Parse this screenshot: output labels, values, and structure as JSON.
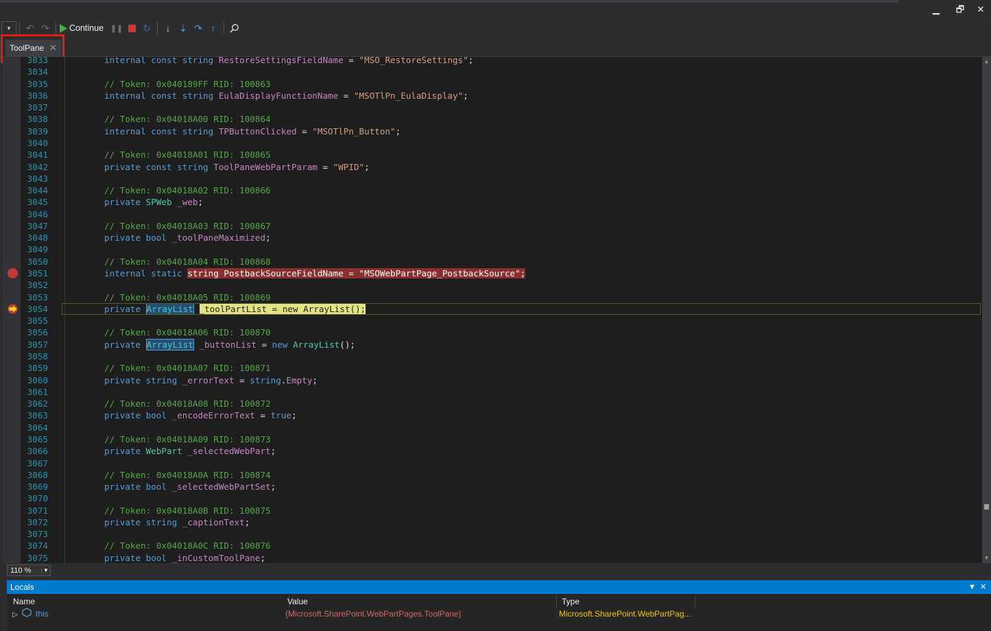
{
  "window": {
    "minimize_label": "▁",
    "maximize_label": "🗗",
    "close_label": "✕"
  },
  "toolbar": {
    "continue_label": "Continue"
  },
  "tab": {
    "title": "ToolPane",
    "close_label": "✕"
  },
  "editor": {
    "zoom": "110 %",
    "breakpoint_line": 3051,
    "current_line": 3054,
    "lines": [
      {
        "n": "3033",
        "t": ""
      },
      {
        "n": "3034",
        "t": ""
      },
      {
        "n": "3035",
        "t": ""
      },
      {
        "n": "3036",
        "t": ""
      },
      {
        "n": "3037",
        "t": ""
      },
      {
        "n": "3038",
        "t": ""
      },
      {
        "n": "3039",
        "t": ""
      },
      {
        "n": "3040",
        "t": ""
      },
      {
        "n": "3041",
        "t": ""
      },
      {
        "n": "3042",
        "t": ""
      },
      {
        "n": "3043",
        "t": ""
      },
      {
        "n": "3044",
        "t": ""
      },
      {
        "n": "3045",
        "t": ""
      },
      {
        "n": "3046",
        "t": ""
      },
      {
        "n": "3047",
        "t": ""
      },
      {
        "n": "3048",
        "t": ""
      },
      {
        "n": "3049",
        "t": ""
      },
      {
        "n": "3050",
        "t": ""
      },
      {
        "n": "3051",
        "t": ""
      },
      {
        "n": "3052",
        "t": ""
      },
      {
        "n": "3053",
        "t": ""
      },
      {
        "n": "3054",
        "t": ""
      },
      {
        "n": "3055",
        "t": ""
      },
      {
        "n": "3056",
        "t": ""
      },
      {
        "n": "3057",
        "t": ""
      },
      {
        "n": "3058",
        "t": ""
      },
      {
        "n": "3059",
        "t": ""
      },
      {
        "n": "3060",
        "t": ""
      },
      {
        "n": "3061",
        "t": ""
      },
      {
        "n": "3062",
        "t": ""
      },
      {
        "n": "3063",
        "t": ""
      },
      {
        "n": "3064",
        "t": ""
      },
      {
        "n": "3065",
        "t": ""
      },
      {
        "n": "3066",
        "t": ""
      },
      {
        "n": "3067",
        "t": ""
      },
      {
        "n": "3068",
        "t": ""
      },
      {
        "n": "3069",
        "t": ""
      },
      {
        "n": "3070",
        "t": ""
      },
      {
        "n": "3071",
        "t": ""
      },
      {
        "n": "3072",
        "t": ""
      },
      {
        "n": "3073",
        "t": ""
      },
      {
        "n": "3074",
        "t": ""
      },
      {
        "n": "3075",
        "t": ""
      }
    ],
    "code": {
      "3033": [
        [
          "kw",
          "internal const string "
        ],
        [
          "fld",
          "RestoreSettingsFieldName"
        ],
        [
          "pl",
          " = "
        ],
        [
          "str",
          "\"MSO_RestoreSettings\""
        ],
        [
          "pl",
          ";"
        ]
      ],
      "3035": [
        [
          "cm",
          "// Token: 0x040189FF RID: 100863"
        ]
      ],
      "3036": [
        [
          "kw",
          "internal const string "
        ],
        [
          "fld",
          "EulaDisplayFunctionName"
        ],
        [
          "pl",
          " = "
        ],
        [
          "str",
          "\"MSOTlPn_EulaDisplay\""
        ],
        [
          "pl",
          ";"
        ]
      ],
      "3038": [
        [
          "cm",
          "// Token: 0x04018A00 RID: 100864"
        ]
      ],
      "3039": [
        [
          "kw",
          "internal const string "
        ],
        [
          "fld",
          "TPButtonClicked"
        ],
        [
          "pl",
          " = "
        ],
        [
          "str",
          "\"MSOTlPn_Button\""
        ],
        [
          "pl",
          ";"
        ]
      ],
      "3041": [
        [
          "cm",
          "// Token: 0x04018A01 RID: 100865"
        ]
      ],
      "3042": [
        [
          "kw",
          "private const string "
        ],
        [
          "fld",
          "ToolPaneWebPartParam"
        ],
        [
          "pl",
          " = "
        ],
        [
          "str",
          "\"WPID\""
        ],
        [
          "pl",
          ";"
        ]
      ],
      "3044": [
        [
          "cm",
          "// Token: 0x04018A02 RID: 100866"
        ]
      ],
      "3045": [
        [
          "kw",
          "private "
        ],
        [
          "ty",
          "SPWeb"
        ],
        [
          "pl",
          " "
        ],
        [
          "fld",
          "_web"
        ],
        [
          "pl",
          ";"
        ]
      ],
      "3047": [
        [
          "cm",
          "// Token: 0x04018A03 RID: 100867"
        ]
      ],
      "3048": [
        [
          "kw",
          "private bool "
        ],
        [
          "fld",
          "_toolPaneMaximized"
        ],
        [
          "pl",
          ";"
        ]
      ],
      "3050": [
        [
          "cm",
          "// Token: 0x04018A04 RID: 100868"
        ]
      ],
      "3051": [
        [
          "kw",
          "internal static "
        ],
        [
          "bp",
          "string PostbackSourceFieldName = \"MSOWebPartPage_PostbackSource\";"
        ]
      ],
      "3053": [
        [
          "cm",
          "// Token: 0x04018A05 RID: 100869"
        ]
      ],
      "3054": [
        [
          "kw",
          "private "
        ],
        [
          "ref",
          "ArrayList"
        ],
        [
          "pl",
          " "
        ],
        [
          "ex",
          "_toolPartList = new ArrayList();"
        ]
      ],
      "3056": [
        [
          "cm",
          "// Token: 0x04018A06 RID: 100870"
        ]
      ],
      "3057": [
        [
          "kw",
          "private "
        ],
        [
          "ref",
          "ArrayList"
        ],
        [
          "pl",
          " "
        ],
        [
          "fld",
          "_buttonList"
        ],
        [
          "pl",
          " = "
        ],
        [
          "kw",
          "new "
        ],
        [
          "ty",
          "ArrayList"
        ],
        [
          "pl",
          "();"
        ]
      ],
      "3059": [
        [
          "cm",
          "// Token: 0x04018A07 RID: 100871"
        ]
      ],
      "3060": [
        [
          "kw",
          "private string "
        ],
        [
          "fld",
          "_errorText"
        ],
        [
          "pl",
          " = "
        ],
        [
          "kw",
          "string"
        ],
        [
          "pl",
          "."
        ],
        [
          "fld",
          "Empty"
        ],
        [
          "pl",
          ";"
        ]
      ],
      "3062": [
        [
          "cm",
          "// Token: 0x04018A08 RID: 100872"
        ]
      ],
      "3063": [
        [
          "kw",
          "private bool "
        ],
        [
          "fld",
          "_encodeErrorText"
        ],
        [
          "pl",
          " = "
        ],
        [
          "kw",
          "true"
        ],
        [
          "pl",
          ";"
        ]
      ],
      "3065": [
        [
          "cm",
          "// Token: 0x04018A09 RID: 100873"
        ]
      ],
      "3066": [
        [
          "kw",
          "private "
        ],
        [
          "ty",
          "WebPart"
        ],
        [
          "pl",
          " "
        ],
        [
          "fld",
          "_selectedWebPart"
        ],
        [
          "pl",
          ";"
        ]
      ],
      "3068": [
        [
          "cm",
          "// Token: 0x04018A0A RID: 100874"
        ]
      ],
      "3069": [
        [
          "kw",
          "private bool "
        ],
        [
          "fld",
          "_selectedWebPartSet"
        ],
        [
          "pl",
          ";"
        ]
      ],
      "3071": [
        [
          "cm",
          "// Token: 0x04018A0B RID: 100875"
        ]
      ],
      "3072": [
        [
          "kw",
          "private string "
        ],
        [
          "fld",
          "_captionText"
        ],
        [
          "pl",
          ";"
        ]
      ],
      "3074": [
        [
          "cm",
          "// Token: 0x04018A0C RID: 100876"
        ]
      ],
      "3075": [
        [
          "kw",
          "private bool "
        ],
        [
          "fld",
          "_inCustomToolPane"
        ],
        [
          "pl",
          ";"
        ]
      ]
    }
  },
  "locals": {
    "title": "Locals",
    "columns": [
      "Name",
      "Value",
      "Type"
    ],
    "rows": [
      {
        "name": "this",
        "value": "{Microsoft.SharePoint.WebPartPages.ToolPane}",
        "type": "Microsoft.SharePoint.WebPartPag..."
      }
    ]
  },
  "colors": {
    "accent": "#007acc",
    "breakpoint": "#c33a3a",
    "highlight_box": "#e41b17"
  }
}
